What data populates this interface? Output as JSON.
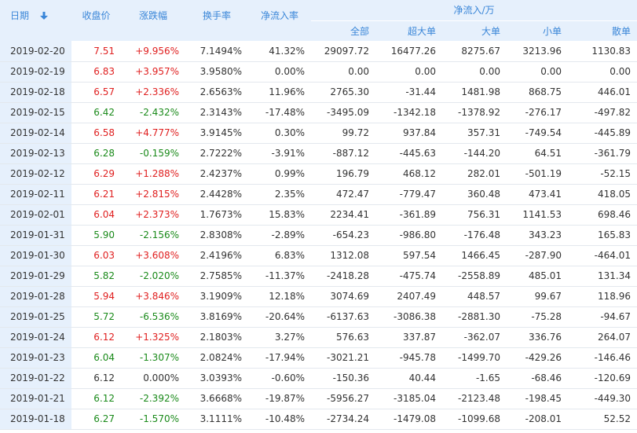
{
  "header": {
    "date": "日期",
    "close": "收盘价",
    "change": "涨跌幅",
    "turnover": "换手率",
    "net_ratio": "净流入率",
    "net_flow": "净流入/万",
    "all": "全部",
    "super_large": "超大单",
    "large": "大单",
    "small": "小单",
    "retail": "散单"
  },
  "icons": {
    "sort": "sort-down-arrow-icon"
  },
  "colors": {
    "up": "#e02020",
    "down": "#1a8a1a",
    "header_bg": "#e6f0fc",
    "header_text": "#3a86d8"
  },
  "rows": [
    {
      "date": "2019-02-20",
      "close": "7.51",
      "change": "+9.956%",
      "dir": "up",
      "turnover": "7.1494%",
      "net_ratio": "41.32%",
      "all": "29097.72",
      "super_large": "16477.26",
      "large": "8275.67",
      "small": "3213.96",
      "retail": "1130.83"
    },
    {
      "date": "2019-02-19",
      "close": "6.83",
      "change": "+3.957%",
      "dir": "up",
      "turnover": "3.9580%",
      "net_ratio": "0.00%",
      "all": "0.00",
      "super_large": "0.00",
      "large": "0.00",
      "small": "0.00",
      "retail": "0.00"
    },
    {
      "date": "2019-02-18",
      "close": "6.57",
      "change": "+2.336%",
      "dir": "up",
      "turnover": "2.6563%",
      "net_ratio": "11.96%",
      "all": "2765.30",
      "super_large": "-31.44",
      "large": "1481.98",
      "small": "868.75",
      "retail": "446.01"
    },
    {
      "date": "2019-02-15",
      "close": "6.42",
      "change": "-2.432%",
      "dir": "down",
      "turnover": "2.3143%",
      "net_ratio": "-17.48%",
      "all": "-3495.09",
      "super_large": "-1342.18",
      "large": "-1378.92",
      "small": "-276.17",
      "retail": "-497.82"
    },
    {
      "date": "2019-02-14",
      "close": "6.58",
      "change": "+4.777%",
      "dir": "up",
      "turnover": "3.9145%",
      "net_ratio": "0.30%",
      "all": "99.72",
      "super_large": "937.84",
      "large": "357.31",
      "small": "-749.54",
      "retail": "-445.89"
    },
    {
      "date": "2019-02-13",
      "close": "6.28",
      "change": "-0.159%",
      "dir": "down",
      "turnover": "2.7222%",
      "net_ratio": "-3.91%",
      "all": "-887.12",
      "super_large": "-445.63",
      "large": "-144.20",
      "small": "64.51",
      "retail": "-361.79"
    },
    {
      "date": "2019-02-12",
      "close": "6.29",
      "change": "+1.288%",
      "dir": "up",
      "turnover": "2.4237%",
      "net_ratio": "0.99%",
      "all": "196.79",
      "super_large": "468.12",
      "large": "282.01",
      "small": "-501.19",
      "retail": "-52.15"
    },
    {
      "date": "2019-02-11",
      "close": "6.21",
      "change": "+2.815%",
      "dir": "up",
      "turnover": "2.4428%",
      "net_ratio": "2.35%",
      "all": "472.47",
      "super_large": "-779.47",
      "large": "360.48",
      "small": "473.41",
      "retail": "418.05"
    },
    {
      "date": "2019-02-01",
      "close": "6.04",
      "change": "+2.373%",
      "dir": "up",
      "turnover": "1.7673%",
      "net_ratio": "15.83%",
      "all": "2234.41",
      "super_large": "-361.89",
      "large": "756.31",
      "small": "1141.53",
      "retail": "698.46"
    },
    {
      "date": "2019-01-31",
      "close": "5.90",
      "change": "-2.156%",
      "dir": "down",
      "turnover": "2.8308%",
      "net_ratio": "-2.89%",
      "all": "-654.23",
      "super_large": "-986.80",
      "large": "-176.48",
      "small": "343.23",
      "retail": "165.83"
    },
    {
      "date": "2019-01-30",
      "close": "6.03",
      "change": "+3.608%",
      "dir": "up",
      "turnover": "2.4196%",
      "net_ratio": "6.83%",
      "all": "1312.08",
      "super_large": "597.54",
      "large": "1466.45",
      "small": "-287.90",
      "retail": "-464.01"
    },
    {
      "date": "2019-01-29",
      "close": "5.82",
      "change": "-2.020%",
      "dir": "down",
      "turnover": "2.7585%",
      "net_ratio": "-11.37%",
      "all": "-2418.28",
      "super_large": "-475.74",
      "large": "-2558.89",
      "small": "485.01",
      "retail": "131.34"
    },
    {
      "date": "2019-01-28",
      "close": "5.94",
      "change": "+3.846%",
      "dir": "up",
      "turnover": "3.1909%",
      "net_ratio": "12.18%",
      "all": "3074.69",
      "super_large": "2407.49",
      "large": "448.57",
      "small": "99.67",
      "retail": "118.96"
    },
    {
      "date": "2019-01-25",
      "close": "5.72",
      "change": "-6.536%",
      "dir": "down",
      "turnover": "3.8169%",
      "net_ratio": "-20.64%",
      "all": "-6137.63",
      "super_large": "-3086.38",
      "large": "-2881.30",
      "small": "-75.28",
      "retail": "-94.67"
    },
    {
      "date": "2019-01-24",
      "close": "6.12",
      "change": "+1.325%",
      "dir": "up",
      "turnover": "2.1803%",
      "net_ratio": "3.27%",
      "all": "576.63",
      "super_large": "337.87",
      "large": "-362.07",
      "small": "336.76",
      "retail": "264.07"
    },
    {
      "date": "2019-01-23",
      "close": "6.04",
      "change": "-1.307%",
      "dir": "down",
      "turnover": "2.0824%",
      "net_ratio": "-17.94%",
      "all": "-3021.21",
      "super_large": "-945.78",
      "large": "-1499.70",
      "small": "-429.26",
      "retail": "-146.46"
    },
    {
      "date": "2019-01-22",
      "close": "6.12",
      "change": "0.000%",
      "dir": "flat",
      "turnover": "3.0393%",
      "net_ratio": "-0.60%",
      "all": "-150.36",
      "super_large": "40.44",
      "large": "-1.65",
      "small": "-68.46",
      "retail": "-120.69"
    },
    {
      "date": "2019-01-21",
      "close": "6.12",
      "change": "-2.392%",
      "dir": "down",
      "turnover": "3.6668%",
      "net_ratio": "-19.87%",
      "all": "-5956.27",
      "super_large": "-3185.04",
      "large": "-2123.48",
      "small": "-198.45",
      "retail": "-449.30"
    },
    {
      "date": "2019-01-18",
      "close": "6.27",
      "change": "-1.570%",
      "dir": "down",
      "turnover": "3.1111%",
      "net_ratio": "-10.48%",
      "all": "-2734.24",
      "super_large": "-1479.08",
      "large": "-1099.68",
      "small": "-208.01",
      "retail": "52.52"
    }
  ]
}
